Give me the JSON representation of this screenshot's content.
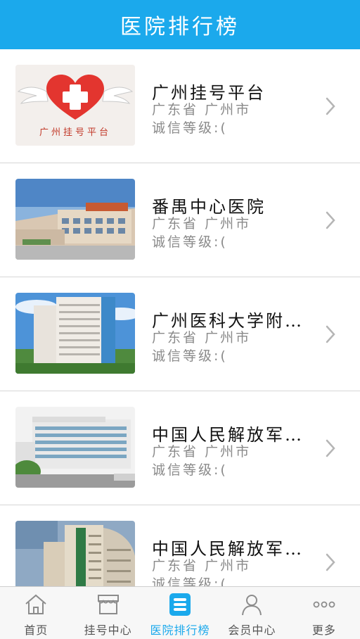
{
  "header": {
    "title": "医院排行榜"
  },
  "list": [
    {
      "name": "广州挂号平台",
      "province": "广东省",
      "city": "广州市",
      "credit_label": "诚信等级:(",
      "thumb": "heart-logo-image",
      "logo_text": "广州挂号平台"
    },
    {
      "name": "番禺中心医院",
      "province": "广东省",
      "city": "广州市",
      "credit_label": "诚信等级:(",
      "thumb": "hospital-building-image"
    },
    {
      "name": "广州医科大学附…",
      "province": "广东省",
      "city": "广州市",
      "credit_label": "诚信等级:(",
      "thumb": "hospital-tower-image"
    },
    {
      "name": "中国人民解放军…",
      "province": "广东省",
      "city": "广州市",
      "credit_label": "诚信等级:(",
      "thumb": "army-hospital-image"
    },
    {
      "name": "中国人民解放军…",
      "province": "广东省",
      "city": "广州市",
      "credit_label": "诚信等级:(",
      "thumb": "army-hospital-tower-image"
    }
  ],
  "tabbar": {
    "active_index": 2,
    "active_color": "#1ba9ec",
    "tabs": [
      {
        "label": "首页",
        "icon": "home-icon"
      },
      {
        "label": "挂号中心",
        "icon": "store-icon"
      },
      {
        "label": "医院排行榜",
        "icon": "ranking-list-icon"
      },
      {
        "label": "会员中心",
        "icon": "user-icon"
      },
      {
        "label": "更多",
        "icon": "more-dots-icon"
      }
    ]
  },
  "colors": {
    "header": "#1ba9ec",
    "text_primary": "#111111",
    "text_secondary": "#8a8a8a"
  }
}
